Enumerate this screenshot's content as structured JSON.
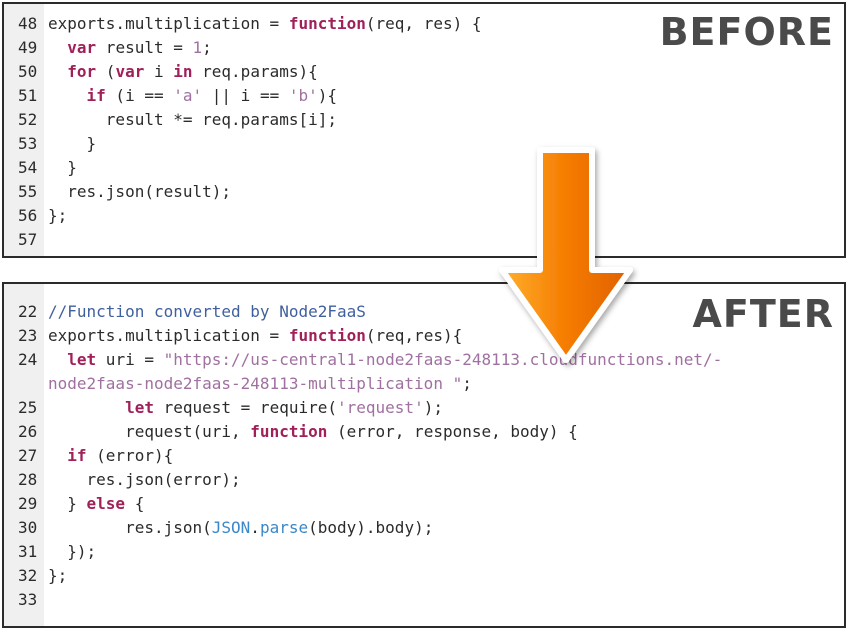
{
  "before": {
    "label": "BEFORE",
    "lines": [
      {
        "n": "48",
        "segments": [
          {
            "t": "exports.multiplication = "
          },
          {
            "t": "function",
            "k": "kw"
          },
          {
            "t": "(req, res) {"
          }
        ]
      },
      {
        "n": "49",
        "segments": [
          {
            "t": "  "
          },
          {
            "t": "var",
            "k": "kw"
          },
          {
            "t": " result = "
          },
          {
            "t": "1",
            "k": "str"
          },
          {
            "t": ";"
          }
        ]
      },
      {
        "n": "50",
        "segments": [
          {
            "t": "  "
          },
          {
            "t": "for",
            "k": "kw"
          },
          {
            "t": " ("
          },
          {
            "t": "var",
            "k": "kw"
          },
          {
            "t": " i "
          },
          {
            "t": "in",
            "k": "kw"
          },
          {
            "t": " req.params){"
          }
        ]
      },
      {
        "n": "51",
        "segments": [
          {
            "t": "    "
          },
          {
            "t": "if",
            "k": "kw"
          },
          {
            "t": " (i == "
          },
          {
            "t": "'a'",
            "k": "str"
          },
          {
            "t": " || i == "
          },
          {
            "t": "'b'",
            "k": "str"
          },
          {
            "t": "){"
          }
        ]
      },
      {
        "n": "52",
        "segments": [
          {
            "t": "      result *= req.params[i];"
          }
        ]
      },
      {
        "n": "53",
        "segments": [
          {
            "t": "    }"
          }
        ]
      },
      {
        "n": "54",
        "segments": [
          {
            "t": "  }"
          }
        ]
      },
      {
        "n": "55",
        "segments": [
          {
            "t": "  res.json(result);"
          }
        ]
      },
      {
        "n": "56",
        "segments": [
          {
            "t": "};"
          }
        ]
      },
      {
        "n": "57",
        "segments": []
      }
    ]
  },
  "after": {
    "label": "AFTER",
    "lines": [
      {
        "n": "22",
        "segments": [
          {
            "t": "//Function converted by Node2FaaS",
            "k": "cm"
          }
        ]
      },
      {
        "n": "23",
        "segments": [
          {
            "t": "exports.multiplication = "
          },
          {
            "t": "function",
            "k": "kw"
          },
          {
            "t": "(req,res){"
          }
        ]
      },
      {
        "n": "24",
        "segments": [
          {
            "t": "  "
          },
          {
            "t": "let",
            "k": "kw"
          },
          {
            "t": " uri = "
          },
          {
            "t": "\"https://us-central1-node2faas-248113.cloudfunctions.net/-",
            "k": "str"
          }
        ]
      },
      {
        "n": "",
        "segments": [
          {
            "t": "node2faas-node2faas-248113-multiplication \"",
            "k": "str"
          },
          {
            "t": ";"
          }
        ]
      },
      {
        "n": "25",
        "segments": [
          {
            "t": "        "
          },
          {
            "t": "let",
            "k": "kw"
          },
          {
            "t": " request = require("
          },
          {
            "t": "'request'",
            "k": "str"
          },
          {
            "t": ");"
          }
        ]
      },
      {
        "n": "26",
        "segments": [
          {
            "t": "        request(uri, "
          },
          {
            "t": "function",
            "k": "kw"
          },
          {
            "t": " (error, response, body) {"
          }
        ]
      },
      {
        "n": "27",
        "segments": [
          {
            "t": "  "
          },
          {
            "t": "if",
            "k": "kw"
          },
          {
            "t": " (error){"
          }
        ]
      },
      {
        "n": "28",
        "segments": [
          {
            "t": "    res.json(error);"
          }
        ]
      },
      {
        "n": "29",
        "segments": [
          {
            "t": "  } "
          },
          {
            "t": "else",
            "k": "kw"
          },
          {
            "t": " {"
          }
        ]
      },
      {
        "n": "30",
        "segments": [
          {
            "t": "        res.json("
          },
          {
            "t": "JSON",
            "k": "bi"
          },
          {
            "t": "."
          },
          {
            "t": "parse",
            "k": "bi"
          },
          {
            "t": "(body).body);"
          }
        ]
      },
      {
        "n": "31",
        "segments": [
          {
            "t": "  });"
          }
        ]
      },
      {
        "n": "32",
        "segments": [
          {
            "t": "};"
          }
        ]
      },
      {
        "n": "33",
        "segments": []
      }
    ]
  },
  "colors": {
    "keyword": "#a0205a",
    "string": "#a070a0",
    "comment": "#3f5f9f",
    "builtin": "#3a87c9",
    "arrow": "#f57c00",
    "label": "#4a4a4a"
  },
  "icons": {
    "arrow": "down-arrow-icon"
  }
}
